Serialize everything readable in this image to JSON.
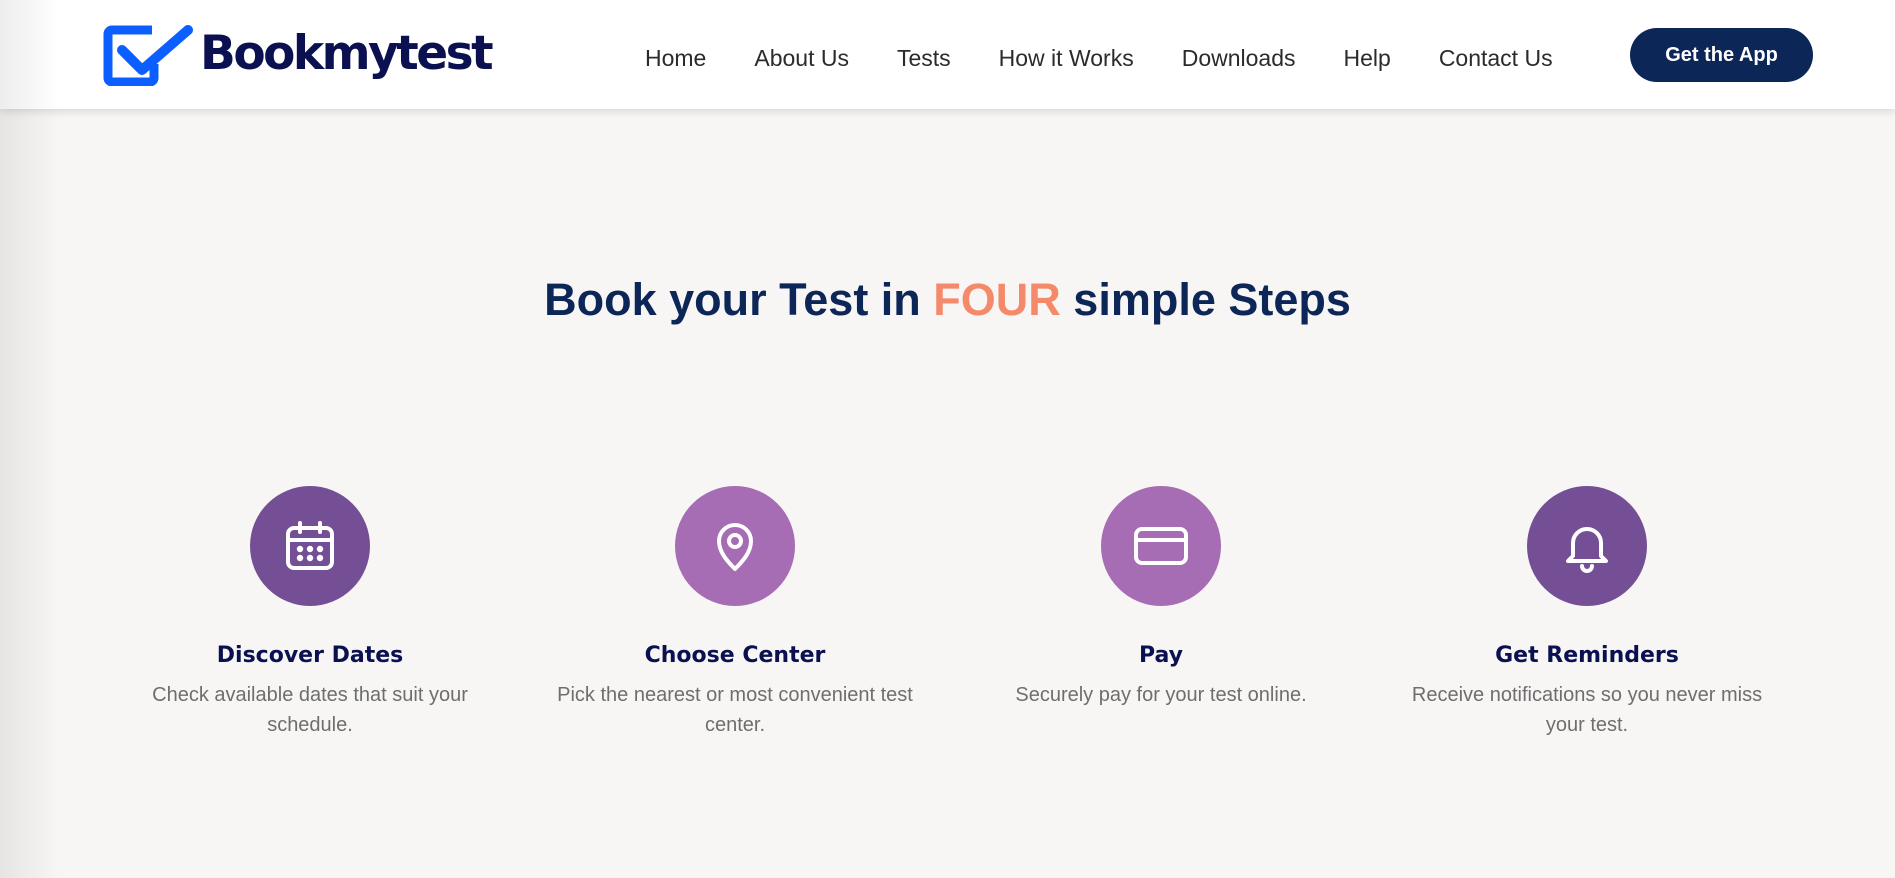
{
  "header": {
    "logo_text": "Bookmytest",
    "logo_color": "#0b5fff",
    "nav": [
      "Home",
      "About Us",
      "Tests",
      "How it Works",
      "Downloads",
      "Help",
      "Contact Us"
    ],
    "cta_label": "Get the App",
    "cta_color": "#0c2658"
  },
  "hero": {
    "title_before": "Book your Test in ",
    "title_accent": "FOUR",
    "title_after": " simple Steps",
    "title_color": "#0c2658",
    "accent_color": "#f48a6a"
  },
  "steps": [
    {
      "icon": "calendar-icon",
      "color": "#754f96",
      "title": "Discover Dates",
      "desc": "Check available dates that suit your schedule."
    },
    {
      "icon": "map-pin-icon",
      "color": "#a66cb4",
      "title": "Choose Center",
      "desc": "Pick the nearest or most convenient test center."
    },
    {
      "icon": "credit-card-icon",
      "color": "#a66cb4",
      "title": "Pay",
      "desc": "Securely pay for your test online."
    },
    {
      "icon": "bell-icon",
      "color": "#754f96",
      "title": "Get Reminders",
      "desc": "Receive notifications so you never miss your test."
    }
  ]
}
